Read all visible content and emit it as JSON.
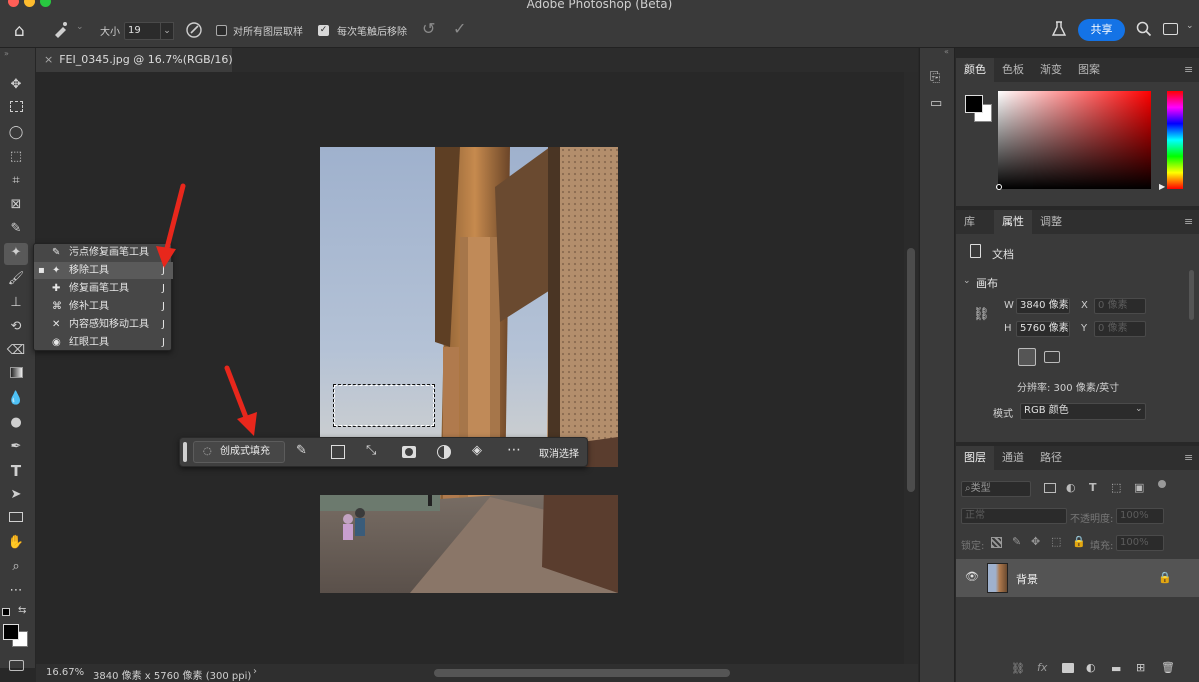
{
  "window": {
    "title": "Adobe Photoshop (Beta)"
  },
  "options_bar": {
    "size_label": "大小",
    "size_value": "19",
    "sample_all_layers_label": "对所有图层取样",
    "remove_after_stroke_label": "每次笔触后移除",
    "share_label": "共享"
  },
  "document_tab": {
    "title": "FEI_0345.jpg @ 16.7%(RGB/16)"
  },
  "tool_flyout": {
    "items": [
      {
        "label": "污点修复画笔工具",
        "shortcut": "J"
      },
      {
        "label": "移除工具",
        "shortcut": "J"
      },
      {
        "label": "修复画笔工具",
        "shortcut": "J"
      },
      {
        "label": "修补工具",
        "shortcut": "J"
      },
      {
        "label": "内容感知移动工具",
        "shortcut": "J"
      },
      {
        "label": "红眼工具",
        "shortcut": "J"
      }
    ]
  },
  "contextual_taskbar": {
    "generative_fill_label": "创成式填充",
    "deselect_label": "取消选择"
  },
  "status_bar": {
    "zoom": "16.67%",
    "doc_info": "3840 像素 x 5760 像素 (300 ppi)"
  },
  "color_panel": {
    "tabs": [
      "颜色",
      "色板",
      "渐变",
      "图案"
    ]
  },
  "properties_panel": {
    "tabs": [
      "库",
      "属性",
      "调整"
    ],
    "doc_label": "文档",
    "canvas_section": "画布",
    "w_label": "W",
    "w_value": "3840 像素",
    "h_label": "H",
    "h_value": "5760 像素",
    "x_label": "X",
    "x_placeholder": "0 像素",
    "y_label": "Y",
    "y_placeholder": "0 像素",
    "resolution": "分辨率: 300 像素/英寸",
    "mode_label": "模式",
    "mode_value": "RGB 颜色"
  },
  "layers_panel": {
    "tabs": [
      "图层",
      "通道",
      "路径"
    ],
    "filter_label": "类型",
    "blend_mode": "正常",
    "opacity_label": "不透明度:",
    "opacity_value": "100%",
    "lock_label": "锁定:",
    "fill_label": "填充:",
    "fill_value": "100%",
    "layer_name": "背景"
  },
  "colors": {
    "accent": "#1473e6",
    "annotation_red": "#e8271c"
  }
}
